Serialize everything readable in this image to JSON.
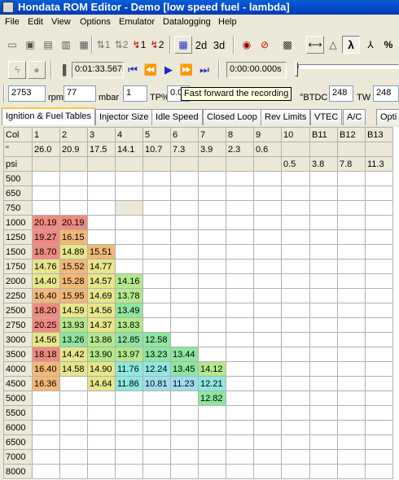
{
  "window": {
    "title": "Hondata ROM Editor - Demo [low speed fuel - lambda]"
  },
  "menu": [
    "File",
    "Edit",
    "View",
    "Options",
    "Emulator",
    "Datalogging",
    "Help"
  ],
  "toolbar": {
    "btn_1": "1",
    "btn_2": "2",
    "rec1": "1",
    "rec2": "2",
    "view_2d": "2d",
    "view_3d": "3d",
    "lambda": "λ",
    "percent": "%"
  },
  "datalog": {
    "elapsed": "0:01:33.567s",
    "offset": "0:00:00.000s"
  },
  "sensors": {
    "rpm_value": "2753",
    "rpm_unit": "rpm",
    "map_value": "77",
    "map_unit": "mbar",
    "tps_value": "1",
    "tps_unit": "TP%",
    "ign_value": "0.0",
    "ign_unit": "°BTDC",
    "tw_value1": "248",
    "tw_unit": "TW",
    "tw_value2": "248"
  },
  "tooltip": "Fast forward the recording",
  "tabs": [
    "Ignition & Fuel Tables",
    "Injector Size",
    "Idle Speed",
    "Closed Loop",
    "Rev Limits",
    "VTEC",
    "A/C",
    "Opti"
  ],
  "table": {
    "col_row": [
      "Col",
      "1",
      "2",
      "3",
      "4",
      "5",
      "6",
      "7",
      "8",
      "9",
      "10",
      "B11",
      "B12",
      "B13"
    ],
    "inch_row": [
      "\"",
      "26.0",
      "20.9",
      "17.5",
      "14.1",
      "10.7",
      "7.3",
      "3.9",
      "2.3",
      "0.6",
      "",
      "",
      "",
      ""
    ],
    "psi_row": [
      "psi",
      "",
      "",
      "",
      "",
      "",
      "",
      "",
      "",
      "",
      "0.5",
      "3.8",
      "7.8",
      "11.3"
    ],
    "rows": [
      {
        "rpm": "500",
        "cells": []
      },
      {
        "rpm": "650",
        "cells": []
      },
      {
        "rpm": "750",
        "cells": []
      },
      {
        "rpm": "1000",
        "cells": [
          "20.19",
          "20.19"
        ]
      },
      {
        "rpm": "1250",
        "cells": [
          "19.27",
          "16.15"
        ]
      },
      {
        "rpm": "1500",
        "cells": [
          "18.70",
          "14.89",
          "15.51"
        ]
      },
      {
        "rpm": "1750",
        "cells": [
          "14.76",
          "15.52",
          "14.77"
        ]
      },
      {
        "rpm": "2000",
        "cells": [
          "14.40",
          "15.28",
          "14.57",
          "14.16"
        ]
      },
      {
        "rpm": "2250",
        "cells": [
          "16.40",
          "15.95",
          "14.69",
          "13.78"
        ]
      },
      {
        "rpm": "2500",
        "cells": [
          "18.20",
          "14.59",
          "14.56",
          "13.49"
        ]
      },
      {
        "rpm": "2750",
        "cells": [
          "20.25",
          "13.93",
          "14.37",
          "13.83"
        ]
      },
      {
        "rpm": "3000",
        "cells": [
          "14.56",
          "13.26",
          "13.86",
          "12.85",
          "12.58"
        ]
      },
      {
        "rpm": "3500",
        "cells": [
          "18.18",
          "14.42",
          "13.90",
          "13.97",
          "13.23",
          "13.44"
        ]
      },
      {
        "rpm": "4000",
        "cells": [
          "16.40",
          "14.58",
          "14.90",
          "11.76",
          "12.24",
          "13.45",
          "14.12"
        ]
      },
      {
        "rpm": "4500",
        "cells": [
          "16.36",
          "",
          "14.64",
          "11.86",
          "10.81",
          "11.23",
          "12.21"
        ]
      },
      {
        "rpm": "5000",
        "cells": [
          "",
          "",
          "",
          "",
          "",
          "",
          "12.82"
        ]
      },
      {
        "rpm": "5500",
        "cells": []
      },
      {
        "rpm": "6000",
        "cells": []
      },
      {
        "rpm": "6500",
        "cells": []
      },
      {
        "rpm": "7000",
        "cells": []
      },
      {
        "rpm": "8000",
        "cells": []
      }
    ]
  },
  "colors": {
    "title_blue": "#0a5fd6",
    "cell_red": "#f08a80",
    "cell_orange": "#f2b877",
    "cell_yellow": "#e8e68a",
    "cell_lgreen": "#b4e88c",
    "cell_green": "#8ee6a0",
    "cell_cyan": "#8ee8e0",
    "cell_blue": "#a0dcf0"
  }
}
